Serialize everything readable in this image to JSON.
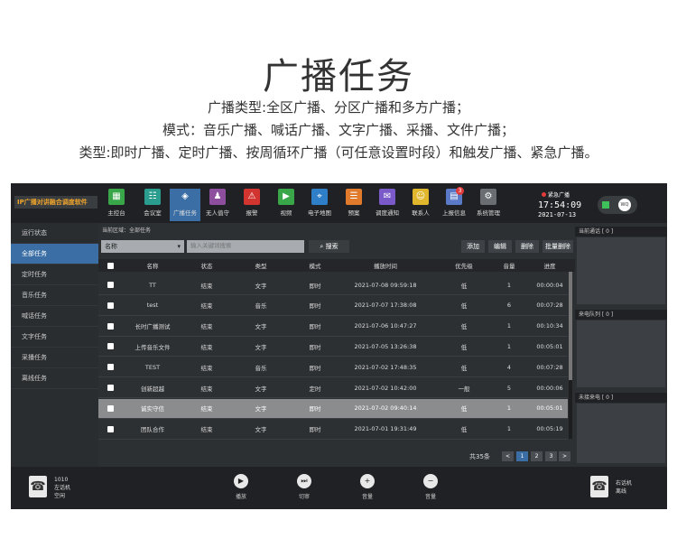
{
  "hero": {
    "title": "广播任务",
    "line1": "广播类型:全区广播、分区广播和多方广播；",
    "line2": "模式：音乐广播、喊话广播、文字广播、采播、文件广播；",
    "line3": "类型:即时广播、定时广播、按周循环广播（可任意设置时段）和触发广播、紧急广播。"
  },
  "app": {
    "brand": "IP广播对讲融合调度软件",
    "toolbar": [
      {
        "label": "主控台",
        "icon": "grid-icon",
        "color": "#3aa64a",
        "glyph": "▦"
      },
      {
        "label": "会议室",
        "icon": "meeting-icon",
        "color": "#2a9d8f",
        "glyph": "☷"
      },
      {
        "label": "广播任务",
        "icon": "broadcast-icon",
        "color": "#3a6ea5",
        "glyph": "◈",
        "active": true
      },
      {
        "label": "无人值守",
        "icon": "unattended-icon",
        "color": "#8e4e9e",
        "glyph": "♟"
      },
      {
        "label": "报警",
        "icon": "alarm-icon",
        "color": "#d2342f",
        "glyph": "⚠"
      },
      {
        "label": "视频",
        "icon": "video-icon",
        "color": "#3aa64a",
        "glyph": "▶"
      },
      {
        "label": "电子地图",
        "icon": "map-icon",
        "color": "#2f7fc8",
        "glyph": "⌖"
      },
      {
        "label": "预案",
        "icon": "plan-icon",
        "color": "#e07a2c",
        "glyph": "☰"
      },
      {
        "label": "调度通知",
        "icon": "notice-icon",
        "color": "#7a5ac8",
        "glyph": "✉"
      },
      {
        "label": "联系人",
        "icon": "contacts-icon",
        "color": "#e0b62c",
        "glyph": "☺"
      },
      {
        "label": "上报信息",
        "icon": "report-icon",
        "color": "#5a7ac8",
        "glyph": "▤",
        "badge": "3"
      },
      {
        "label": "系统管理",
        "icon": "settings-icon",
        "color": "#6a6e72",
        "glyph": "⚙"
      }
    ],
    "urgent_label": "紧急广播",
    "clock": "17:54:09",
    "date": "2021-07-13",
    "user_initials": "WQ",
    "sidebar": [
      "运行状态",
      "全部任务",
      "定时任务",
      "音乐任务",
      "喊话任务",
      "文字任务",
      "采播任务",
      "离线任务"
    ],
    "sidebar_active": 1,
    "breadcrumb": "当前区域：全部任务",
    "filter": {
      "select_value": "名称",
      "search_placeholder": "输入关键词搜索",
      "search_button": "搜索"
    },
    "actions": [
      "添加",
      "编辑",
      "删除",
      "批量删除"
    ],
    "columns": [
      "名称",
      "状态",
      "类型",
      "模式",
      "播放时间",
      "优先级",
      "音量",
      "进度"
    ],
    "rows": [
      {
        "name": "TT",
        "status": "结束",
        "type": "文字",
        "mode": "即时",
        "time": "2021-07-08 09:59:18",
        "priority": "低",
        "volume": "1",
        "progress": "00:00:04"
      },
      {
        "name": "test",
        "status": "结束",
        "type": "音乐",
        "mode": "即时",
        "time": "2021-07-07 17:38:08",
        "priority": "低",
        "volume": "6",
        "progress": "00:07:28"
      },
      {
        "name": "长时广播测试",
        "status": "结束",
        "type": "文字",
        "mode": "即时",
        "time": "2021-07-06 10:47:27",
        "priority": "低",
        "volume": "1",
        "progress": "00:10:34"
      },
      {
        "name": "上传音乐文件",
        "status": "结束",
        "type": "文字",
        "mode": "即时",
        "time": "2021-07-05 13:26:38",
        "priority": "低",
        "volume": "1",
        "progress": "00:05:01"
      },
      {
        "name": "TEST",
        "status": "结束",
        "type": "音乐",
        "mode": "即时",
        "time": "2021-07-02 17:48:35",
        "priority": "低",
        "volume": "4",
        "progress": "00:07:28"
      },
      {
        "name": "创新超越",
        "status": "结束",
        "type": "文字",
        "mode": "定时",
        "time": "2021-07-02 10:42:00",
        "priority": "一般",
        "volume": "5",
        "progress": "00:00:06"
      },
      {
        "name": "诚实守信",
        "status": "结束",
        "type": "文字",
        "mode": "即时",
        "time": "2021-07-02 09:40:14",
        "priority": "低",
        "volume": "1",
        "progress": "00:05:01"
      },
      {
        "name": "团队合作",
        "status": "结束",
        "type": "文字",
        "mode": "即时",
        "time": "2021-07-01 19:31:49",
        "priority": "低",
        "volume": "1",
        "progress": "00:05:19"
      }
    ],
    "highlight_row": 6,
    "pager": {
      "total": "共35条",
      "prev": "<",
      "pages": [
        "1",
        "2",
        "3"
      ],
      "current": 0,
      "next": ">"
    },
    "right_panel": [
      "当前通话 [ 0 ]",
      "来电队列 [ 0 ]",
      "未接来电 [ 0 ]"
    ],
    "bottom_left": {
      "line1": "1010",
      "line2": "左话机",
      "line3": "空闲"
    },
    "controls": [
      {
        "label": "播放",
        "icon": "play-icon",
        "glyph": "▶"
      },
      {
        "label": "切审",
        "icon": "next-track-icon",
        "glyph": "⏭"
      },
      {
        "label": "音量",
        "icon": "volume-up-icon",
        "glyph": "+"
      },
      {
        "label": "音量",
        "icon": "volume-down-icon",
        "glyph": "−"
      }
    ],
    "bottom_right": {
      "line1": "右话机",
      "line2": "离线"
    }
  }
}
